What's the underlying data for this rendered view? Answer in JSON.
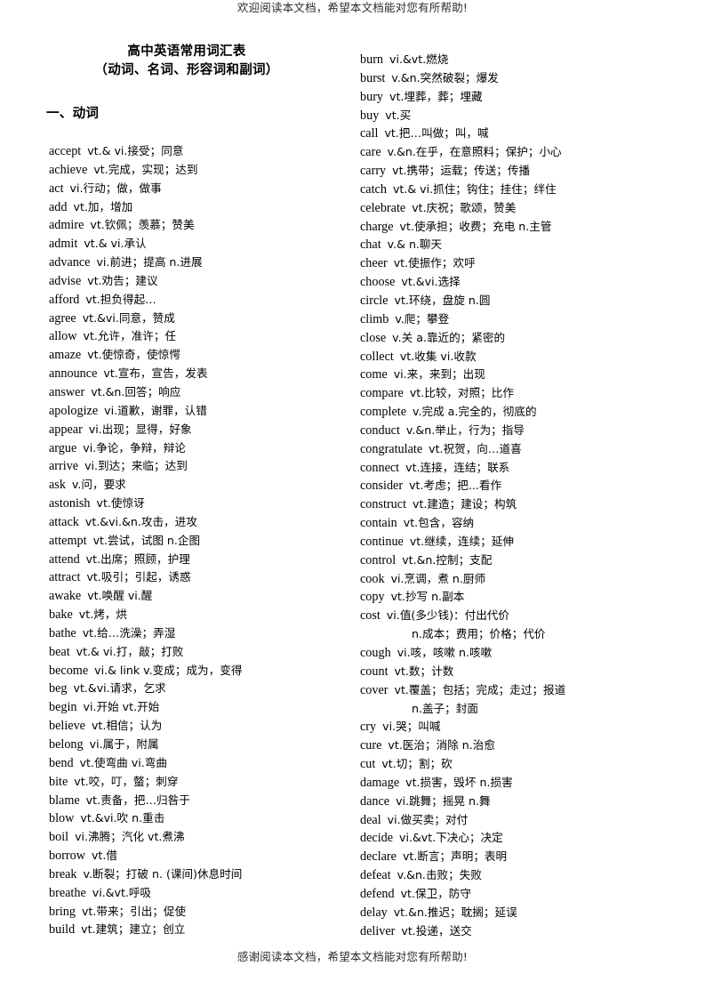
{
  "header": {
    "banner": "欢迎阅读本文档，希望本文档能对您有所帮助!"
  },
  "footer": {
    "banner": "感谢阅读本文档，希望本文档能对您有所帮助!"
  },
  "title": "高中英语常用词汇表",
  "subtitle": "（动词、名词、形容词和副词）",
  "section": "一、动词",
  "columns": {
    "left": [
      {
        "word": "accept",
        "defn": "vt.& vi.接受；同意"
      },
      {
        "word": "achieve",
        "defn": "vt.完成，实现；达到"
      },
      {
        "word": "act",
        "defn": "vi.行动；做，做事"
      },
      {
        "word": "add",
        "defn": "vt.加，增加"
      },
      {
        "word": "admire",
        "defn": "vt.钦佩；羡慕；赞美"
      },
      {
        "word": "admit",
        "defn": "vt.& vi.承认"
      },
      {
        "word": "advance",
        "defn": "vi.前进；提高 n.进展"
      },
      {
        "word": "advise",
        "defn": "vt.劝告；建议"
      },
      {
        "word": "afford",
        "defn": "vt.担负得起…"
      },
      {
        "word": "agree",
        "defn": "vt.&vi.同意，赞成"
      },
      {
        "word": "allow",
        "defn": "vt.允许，准许；任"
      },
      {
        "word": "amaze",
        "defn": "vt.使惊奇，使惊愕"
      },
      {
        "word": "announce",
        "defn": "vt.宣布，宣告，发表"
      },
      {
        "word": "answer",
        "defn": "vt.&n.回答；响应"
      },
      {
        "word": "apologize",
        "defn": "vi.道歉，谢罪，认错"
      },
      {
        "word": "appear",
        "defn": "vi.出现；显得，好象"
      },
      {
        "word": "argue",
        "defn": "vi.争论，争辩，辩论"
      },
      {
        "word": "arrive",
        "defn": "vi.到达；来临；达到"
      },
      {
        "word": "ask",
        "defn": "v.问，要求"
      },
      {
        "word": "astonish",
        "defn": "vt.使惊讶"
      },
      {
        "word": "attack",
        "defn": "vt.&vi.&n.攻击，进攻"
      },
      {
        "word": "attempt",
        "defn": "vt.尝试，试图 n.企图"
      },
      {
        "word": "attend",
        "defn": "vt.出席；照顾，护理"
      },
      {
        "word": "attract",
        "defn": "vt.吸引；引起，诱惑"
      },
      {
        "word": "awake",
        "defn": "vt.唤醒 vi.醒"
      },
      {
        "word": "bake",
        "defn": "vt.烤，烘"
      },
      {
        "word": "bathe",
        "defn": "vt.给…洗澡；弄湿"
      },
      {
        "word": "beat",
        "defn": "vt.& vi.打，敲；打败"
      },
      {
        "word": "become",
        "defn": "vi.& link v.变成；成为，变得"
      },
      {
        "word": "beg",
        "defn": "vt.&vi.请求，乞求"
      },
      {
        "word": "begin",
        "defn": "vi.开始 vt.开始"
      },
      {
        "word": "believe",
        "defn": "vt.相信；认为"
      },
      {
        "word": "belong",
        "defn": "vi.属于，附属"
      },
      {
        "word": "bend",
        "defn": "vt.使弯曲 vi.弯曲"
      },
      {
        "word": "bite",
        "defn": "vt.咬，叮，螫；刺穿"
      },
      {
        "word": "blame",
        "defn": "vt.责备，把…归咎于"
      },
      {
        "word": "blow",
        "defn": "vt.&vi.吹 n.重击"
      },
      {
        "word": "boil",
        "defn": "vi.沸腾；汽化 vt.煮沸"
      },
      {
        "word": "borrow",
        "defn": "vt.借"
      },
      {
        "word": "break",
        "defn": "v.断裂；打破 n. (课间)休息时间"
      },
      {
        "word": "breathe",
        "defn": "vi.&vt.呼吸"
      },
      {
        "word": "bring",
        "defn": "vt.带来；引出；促使"
      },
      {
        "word": "build",
        "defn": "vt.建筑；建立；创立"
      }
    ],
    "right": [
      {
        "word": "burn",
        "defn": "vi.&vt.燃烧"
      },
      {
        "word": "burst",
        "defn": "v.&n.突然破裂；爆发"
      },
      {
        "word": "bury",
        "defn": "vt.埋葬，葬；埋藏"
      },
      {
        "word": "buy",
        "defn": "vt.买"
      },
      {
        "word": "call",
        "defn": "vt.把…叫做；叫，喊"
      },
      {
        "word": "care",
        "defn": "v.&n.在乎，在意照料；保护；小心"
      },
      {
        "word": "carry",
        "defn": "vt.携带；运载；传送；传播"
      },
      {
        "word": "catch",
        "defn": "vt.& vi.抓住；钩住；挂住；绊住"
      },
      {
        "word": "celebrate",
        "defn": "vt.庆祝；歌颂，赞美"
      },
      {
        "word": "charge",
        "defn": "vt.使承担；收费；充电 n.主管"
      },
      {
        "word": "chat",
        "defn": "v.& n.聊天"
      },
      {
        "word": "cheer",
        "defn": "vt.使振作；欢呼"
      },
      {
        "word": "choose",
        "defn": "vt.&vi.选择"
      },
      {
        "word": "circle",
        "defn": "vt.环绕，盘旋 n.圆"
      },
      {
        "word": "climb",
        "defn": "v.爬；攀登"
      },
      {
        "word": "close",
        "defn": "v.关 a.靠近的；紧密的"
      },
      {
        "word": "collect",
        "defn": "vt.收集 vi.收款"
      },
      {
        "word": "come",
        "defn": "vi.来，来到；出现"
      },
      {
        "word": "compare",
        "defn": "vt.比较，对照；比作"
      },
      {
        "word": "complete",
        "defn": "v.完成 a.完全的，彻底的"
      },
      {
        "word": "conduct",
        "defn": "v.&n.举止，行为；指导"
      },
      {
        "word": "congratulate",
        "defn": "vt.祝贺，向…道喜"
      },
      {
        "word": "connect",
        "defn": "vt.连接，连结；联系"
      },
      {
        "word": "consider",
        "defn": "vt.考虑；把...看作"
      },
      {
        "word": "construct",
        "defn": "vt.建造；建设；构筑"
      },
      {
        "word": "contain",
        "defn": "vt.包含，容纳"
      },
      {
        "word": "continue",
        "defn": "vt.继续，连续；延伸"
      },
      {
        "word": "control",
        "defn": "vt.&n.控制；支配"
      },
      {
        "word": "cook",
        "defn": "vi.烹调，煮 n.厨师"
      },
      {
        "word": "copy",
        "defn": "vt.抄写 n.副本"
      },
      {
        "word": "cost",
        "defn": "vi.值(多少钱)：付出代价"
      },
      {
        "word": "",
        "defn": "n.成本；费用；价格；代价",
        "cont": true
      },
      {
        "word": "cough",
        "defn": "vi.咳，咳嗽 n.咳嗽"
      },
      {
        "word": "count",
        "defn": "vt.数；计数"
      },
      {
        "word": "cover",
        "defn": "vt.覆盖；包括；完成；走过；报道"
      },
      {
        "word": "",
        "defn": "n.盖子；封面",
        "cont": true
      },
      {
        "word": "cry",
        "defn": "vi.哭；叫喊"
      },
      {
        "word": "cure",
        "defn": "vt.医治；消除 n.治愈"
      },
      {
        "word": "cut",
        "defn": "vt.切；割；砍"
      },
      {
        "word": "damage",
        "defn": "vt.损害，毁坏 n.损害"
      },
      {
        "word": "dance",
        "defn": "vi.跳舞；摇晃 n.舞"
      },
      {
        "word": "deal",
        "defn": "vi.做买卖；对付"
      },
      {
        "word": "decide",
        "defn": "vi.&vt.下决心；决定"
      },
      {
        "word": "declare",
        "defn": "vt.断言；声明；表明"
      },
      {
        "word": "defeat",
        "defn": "v.&n.击败；失败"
      },
      {
        "word": "defend",
        "defn": "vt.保卫，防守"
      },
      {
        "word": "delay",
        "defn": "vt.&n.推迟；耽搁；延误"
      },
      {
        "word": "deliver",
        "defn": "vt.投递，送交"
      }
    ]
  }
}
